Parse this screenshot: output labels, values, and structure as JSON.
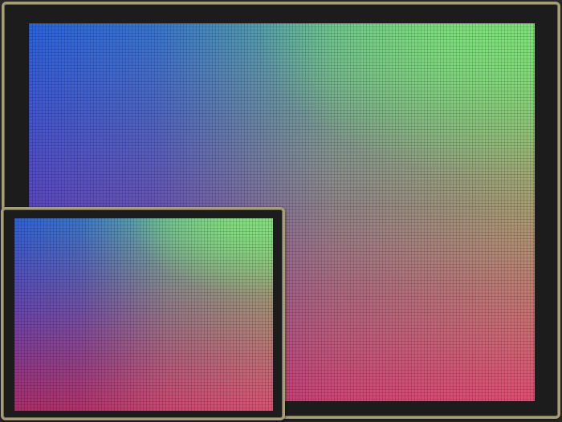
{
  "displays": [
    {
      "id": "primary",
      "screen_gradient": {
        "top_left": "#2a63de",
        "top_right": "#7ddd78",
        "bottom_left": "#a42e7a",
        "bottom_right": "#e04e72"
      },
      "bezel_color": "#1c1c1c",
      "frame_color": "#a59e78"
    },
    {
      "id": "secondary",
      "screen_gradient": {
        "top_left": "#2a63de",
        "top_right": "#7fe07a",
        "bottom_left": "#b12a6a",
        "bottom_right": "#e04e72"
      },
      "bezel_color": "#1c1c1c",
      "frame_color": "#a59e78"
    }
  ]
}
